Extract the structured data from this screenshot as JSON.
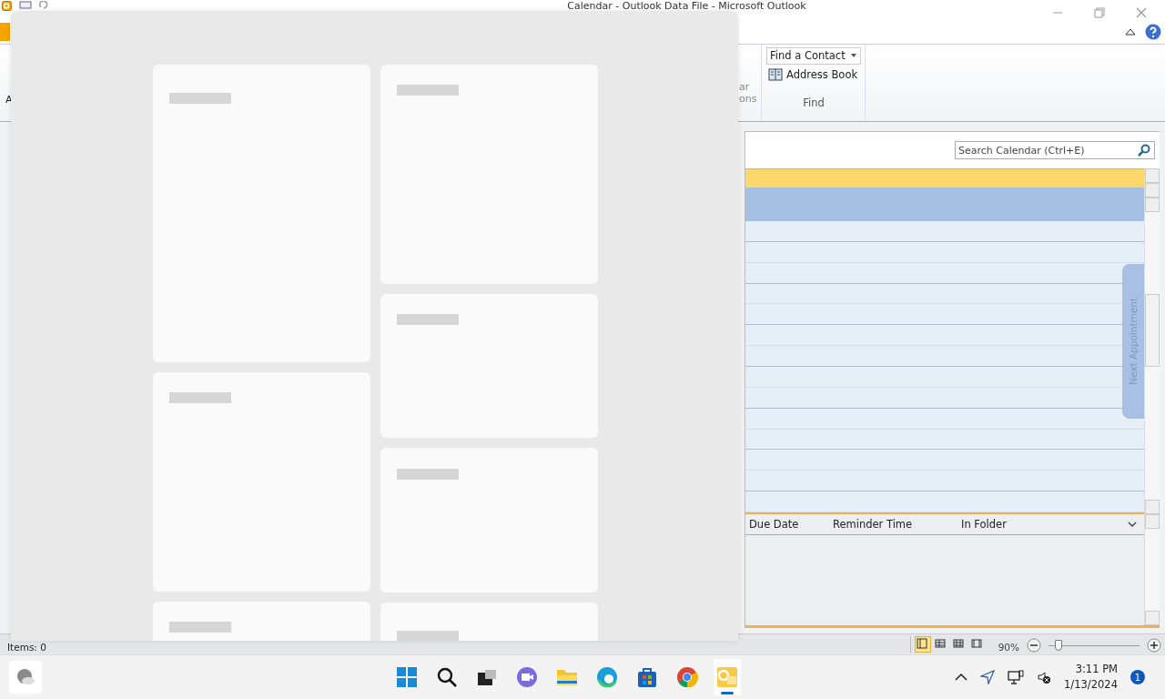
{
  "title_bar": {
    "title": "Calendar - Outlook Data File - Microsoft Outlook"
  },
  "ribbon": {
    "left_fragment": "A",
    "options_fragment": [
      "ar",
      "ons"
    ],
    "find_contact": "Find a Contact",
    "address_book": "Address Book",
    "group_label": "Find"
  },
  "search": {
    "placeholder": "Search Calendar (Ctrl+E)"
  },
  "calendar": {
    "next_appointment": "Next Appointment"
  },
  "task_columns": [
    "Due Date",
    "Reminder Time",
    "In Folder"
  ],
  "status_bar": {
    "items": "Items: 0",
    "views": [
      {
        "kind": "normal",
        "selected": true
      },
      {
        "kind": "grid",
        "selected": false
      },
      {
        "kind": "table",
        "selected": false
      },
      {
        "kind": "reading",
        "selected": false
      }
    ],
    "zoom": "90%",
    "zoom_slider": {
      "level": 0.07
    }
  },
  "taskbar": {
    "apps": [
      {
        "kind": "start",
        "active": false
      },
      {
        "kind": "search",
        "active": false
      },
      {
        "kind": "taskview",
        "active": false
      },
      {
        "kind": "chat",
        "active": false
      },
      {
        "kind": "folder",
        "active": false
      },
      {
        "kind": "edge",
        "active": false
      },
      {
        "kind": "store",
        "active": false
      },
      {
        "kind": "chrome",
        "active": false
      },
      {
        "kind": "outlook",
        "active": true
      }
    ],
    "time": "3:11 PM",
    "date": "1/13/2024",
    "notifications": "1"
  }
}
